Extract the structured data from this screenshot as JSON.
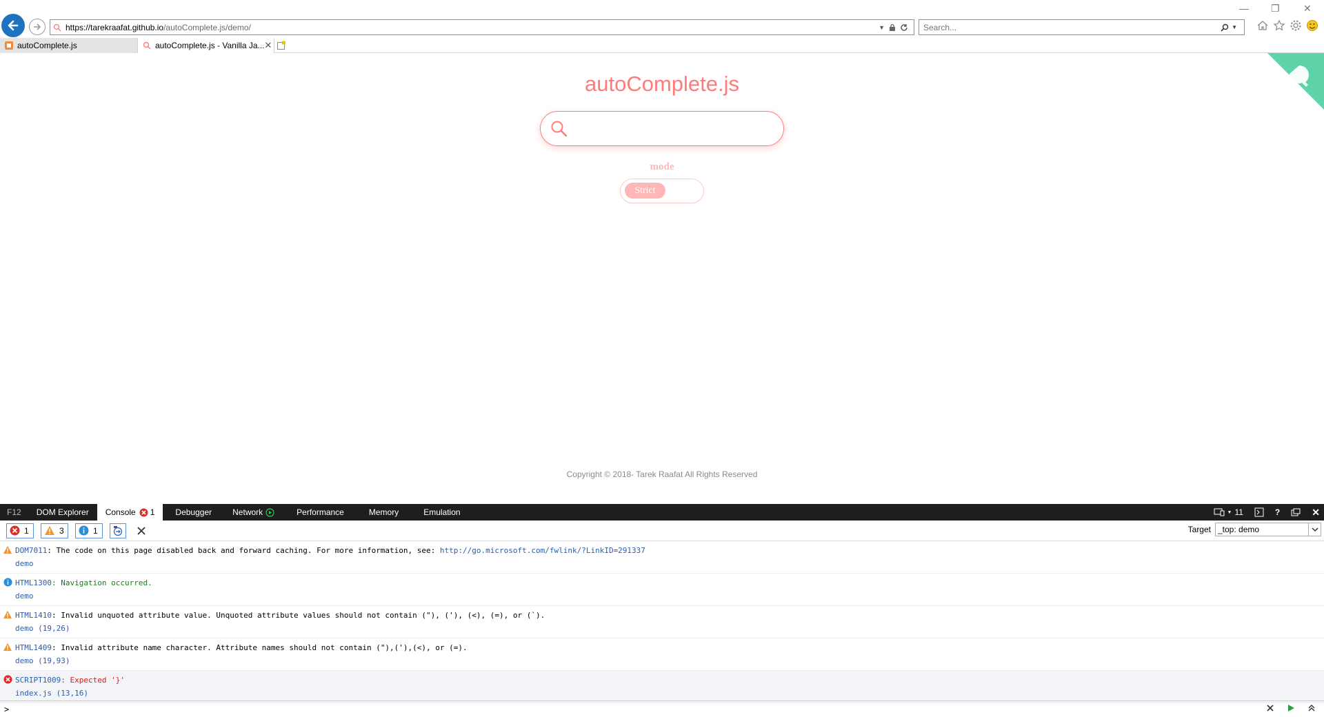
{
  "browser": {
    "url_host": "https://tarekraafat.github.io",
    "url_path": "/autoComplete.js/demo/",
    "search_placeholder": "Search...",
    "tabs": [
      {
        "label": "autoComplete.js"
      },
      {
        "label": "autoComplete.js - Vanilla Ja..."
      }
    ]
  },
  "page": {
    "title": "autoComplete.js",
    "mode_label": "mode",
    "toggle_label": "Strict",
    "copyright": "Copyright © 2018- Tarek Raafat All Rights Reserved"
  },
  "devtools": {
    "tabs": [
      "F12",
      "DOM Explorer",
      "Console",
      "Debugger",
      "Network",
      "Performance",
      "Memory",
      "Emulation"
    ],
    "console_error_badge": "1",
    "emulation_version": "11",
    "filters": {
      "errors": "1",
      "warnings": "3",
      "info": "1"
    },
    "target_label": "Target",
    "target_value": "_top: demo",
    "messages": [
      {
        "level": "warning",
        "code": "DOM7011",
        "text": "The code on this page disabled back and forward caching. For more information, see: ",
        "link": "http://go.microsoft.com/fwlink/?LinkID=291337",
        "source": "demo"
      },
      {
        "level": "info",
        "code": "HTML1300",
        "text": "Navigation occurred.",
        "link": "",
        "source": "demo"
      },
      {
        "level": "warning",
        "code": "HTML1410",
        "text": "Invalid unquoted attribute value. Unquoted attribute values should not contain (\"), ('), (<), (=), or (`).",
        "link": "",
        "source": "demo (19,26)"
      },
      {
        "level": "warning",
        "code": "HTML1409",
        "text": "Invalid attribute name character. Attribute names should not contain (\"),('),(<), or (=).",
        "link": "",
        "source": "demo (19,93)"
      },
      {
        "level": "error",
        "code": "SCRIPT1009",
        "text": "Expected '}'",
        "link": "",
        "source": "index.js (13,16)"
      }
    ],
    "prompt": ">"
  },
  "colors": {
    "accent": "#ff7a7a",
    "accent_light": "#ffb6b6",
    "github_corner": "#5fd3a8",
    "ie_blue": "#1e73be"
  }
}
